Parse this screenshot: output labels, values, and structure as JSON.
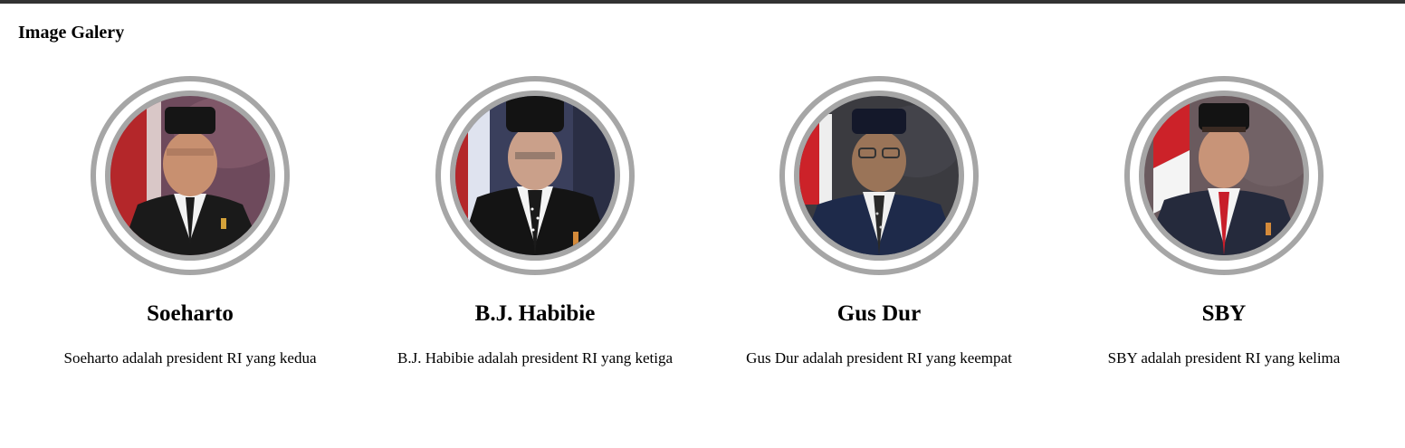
{
  "page": {
    "title": "Image Galery"
  },
  "gallery": {
    "items": [
      {
        "name": "Soeharto",
        "description": "Soeharto adalah president RI yang kedua",
        "photo_icon": "portrait-soeharto",
        "bg_color": "#6e4a5c",
        "suit_color": "#1a1a1a",
        "tie_color": "#1c1c1c"
      },
      {
        "name": "B.J. Habibie",
        "description": "B.J. Habibie adalah president RI yang ketiga",
        "photo_icon": "portrait-habibie",
        "bg_color": "#3a3f5c",
        "suit_color": "#141414",
        "tie_color": "#1a1a1a"
      },
      {
        "name": "Gus Dur",
        "description": "Gus Dur adalah president RI yang keempat",
        "photo_icon": "portrait-gus-dur",
        "bg_color": "#3b3b40",
        "suit_color": "#1e2a4a",
        "tie_color": "#2a2a2a"
      },
      {
        "name": "SBY",
        "description": "SBY adalah president RI yang kelima",
        "photo_icon": "portrait-sby",
        "bg_color": "#6a5a5e",
        "suit_color": "#252a3c",
        "tie_color": "#c81e2a"
      }
    ]
  },
  "colors": {
    "top_bar": "#333333",
    "ring": "#a6a6a6",
    "flag_red": "#cc2229",
    "flag_white": "#f4f4f4"
  }
}
